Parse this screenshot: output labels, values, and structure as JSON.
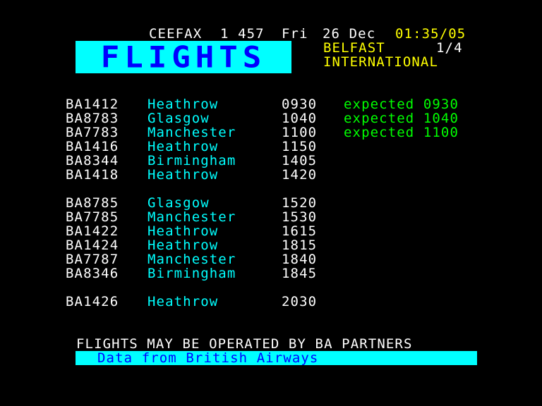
{
  "header": {
    "service": "CEEFAX",
    "page": "1 457",
    "day": "Fri",
    "date": "26 Dec",
    "clock": "01:35/05"
  },
  "logo": {
    "text": "FLIGHTS"
  },
  "airport": {
    "line1": "BELFAST",
    "line2": "INTERNATIONAL",
    "subpage": "1/4"
  },
  "flights": [
    {
      "number": "BA1412",
      "destination": "Heathrow",
      "time": "0930",
      "status": "expected 0930"
    },
    {
      "number": "BA8783",
      "destination": "Glasgow",
      "time": "1040",
      "status": "expected 1040"
    },
    {
      "number": "BA7783",
      "destination": "Manchester",
      "time": "1100",
      "status": "expected 1100"
    },
    {
      "number": "BA1416",
      "destination": "Heathrow",
      "time": "1150",
      "status": ""
    },
    {
      "number": "BA8344",
      "destination": "Birmingham",
      "time": "1405",
      "status": ""
    },
    {
      "number": "BA1418",
      "destination": "Heathrow",
      "time": "1420",
      "status": ""
    },
    {
      "number": "BA8785",
      "destination": "Glasgow",
      "time": "1520",
      "status": ""
    },
    {
      "number": "BA7785",
      "destination": "Manchester",
      "time": "1530",
      "status": ""
    },
    {
      "number": "BA1422",
      "destination": "Heathrow",
      "time": "1615",
      "status": ""
    },
    {
      "number": "BA1424",
      "destination": "Heathrow",
      "time": "1815",
      "status": ""
    },
    {
      "number": "BA7787",
      "destination": "Manchester",
      "time": "1840",
      "status": ""
    },
    {
      "number": "BA8346",
      "destination": "Birmingham",
      "time": "1845",
      "status": ""
    },
    {
      "number": "BA1426",
      "destination": "Heathrow",
      "time": "2030",
      "status": ""
    }
  ],
  "footer": {
    "notice": "FLIGHTS MAY BE OPERATED BY BA PARTNERS",
    "source": "Data from British Airways"
  },
  "colors": {
    "background": "#000000",
    "header_text": "#ffffff",
    "clock": "#ffff00",
    "logo_bg": "#00ffff",
    "logo_text": "#0000ff",
    "flight_number": "#ffffff",
    "destination": "#00ffff",
    "status": "#00ff00",
    "footer_band": "#00ffff",
    "footer_text": "#0000ff"
  }
}
